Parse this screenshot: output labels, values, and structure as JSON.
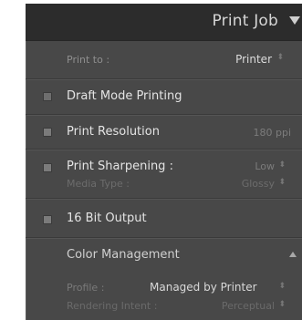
{
  "panel": {
    "title": "Print Job"
  },
  "print_to": {
    "label": "Print to :",
    "value": "Printer"
  },
  "draft_mode": {
    "label": "Draft Mode Printing"
  },
  "print_resolution": {
    "label": "Print Resolution",
    "value": "180 ppi"
  },
  "print_sharpening": {
    "label": "Print Sharpening :",
    "value": "Low",
    "media_label": "Media Type :",
    "media_value": "Glossy"
  },
  "bit_output": {
    "label": "16 Bit Output"
  },
  "color_management": {
    "label": "Color Management",
    "profile_label": "Profile :",
    "profile_value": "Managed by Printer",
    "intent_label": "Rendering Intent :",
    "intent_value": "Perceptual"
  },
  "icons": {
    "collapse": "disclosure-triangle-icon",
    "stepper": "up-down-arrows-icon",
    "checkbox": "checkbox-icon"
  },
  "colors": {
    "panel_bg": "#484848",
    "header_bg": "#2c2c2c",
    "text": "#e4e4e4"
  }
}
